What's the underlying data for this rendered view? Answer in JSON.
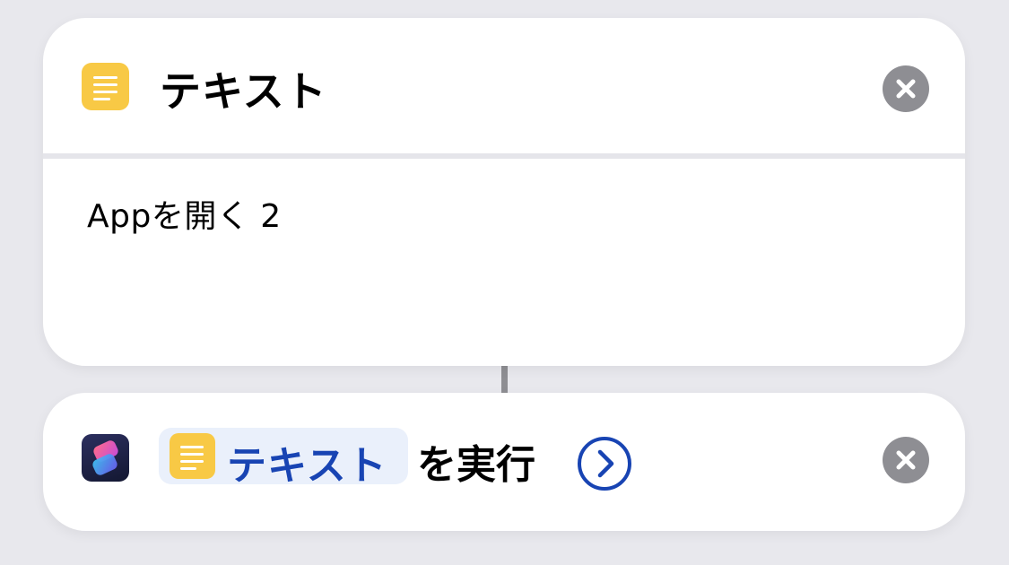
{
  "text_action": {
    "title": "テキスト",
    "icon": "text-doc-icon",
    "icon_color": "#f8c945",
    "content": "Appを開く 2",
    "remove_icon": "close-icon"
  },
  "run_action": {
    "app_icon": "shortcuts-app-icon",
    "variable_token": {
      "label": "テキスト",
      "icon": "text-doc-icon",
      "color": "#1844b3"
    },
    "action_label": "を実行",
    "expand_icon": "chevron-right-circle-icon",
    "remove_icon": "close-icon"
  },
  "colors": {
    "background": "#e8e8ed",
    "card": "#ffffff",
    "accent_blue": "#1844b3",
    "close_gray": "#8e8e93"
  }
}
